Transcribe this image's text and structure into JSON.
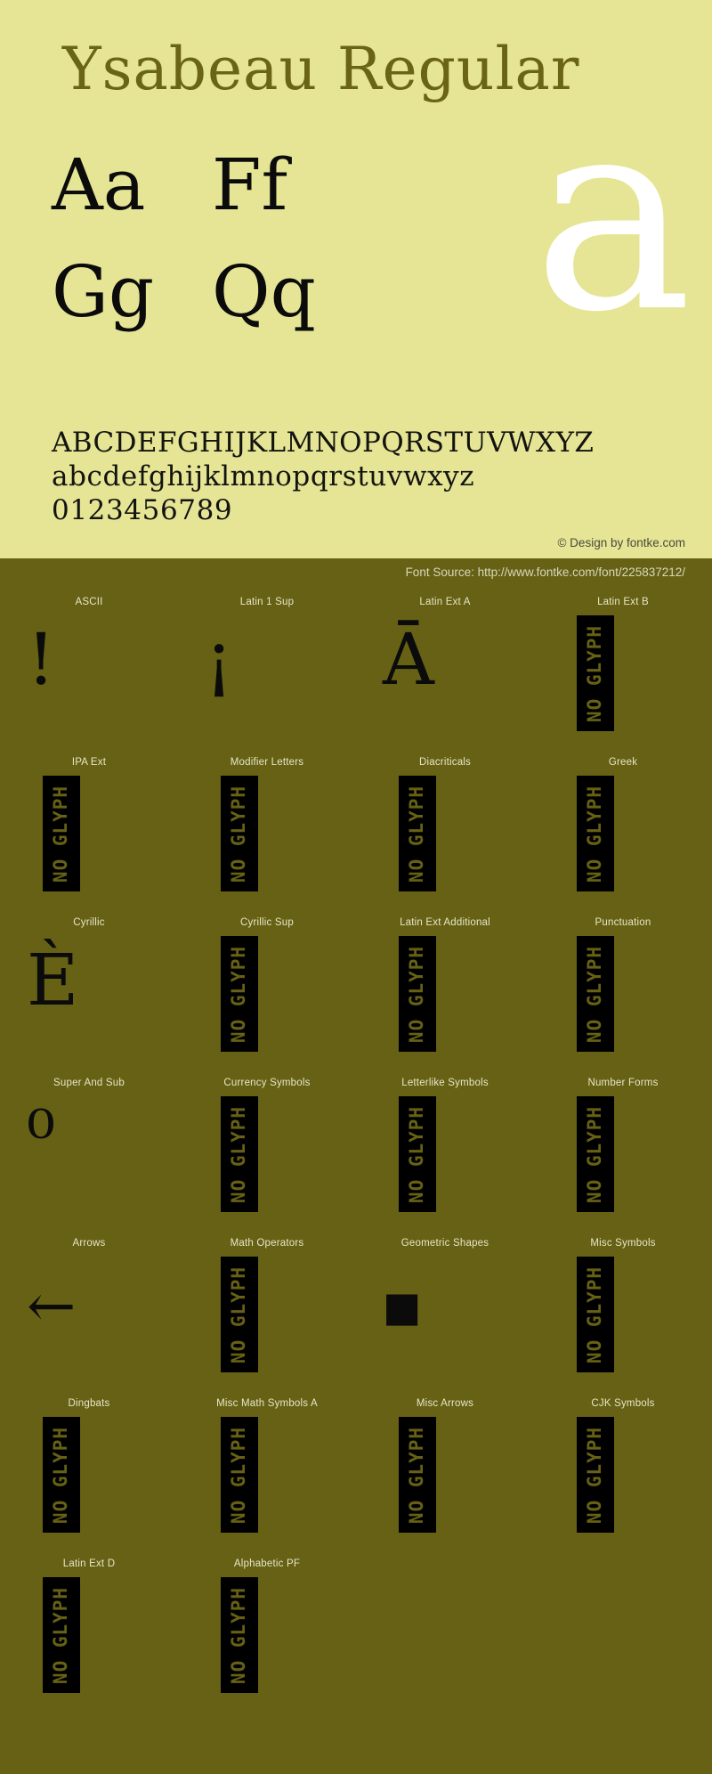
{
  "colors": {
    "light_bg": "#e5e595",
    "dark_bg": "#666114",
    "title_color": "#6a6516",
    "glyph_color": "#0b0b0b",
    "watermark_color": "#ffffff",
    "label_color": "#e6e6c8"
  },
  "specimen": {
    "title": "Ysabeau Regular",
    "watermark_letter": "a",
    "sample_pairs": [
      {
        "col1": "Aa",
        "col2": "Ff"
      },
      {
        "col1": "Gg",
        "col2": "Qq"
      }
    ],
    "alphabet_upper": "ABCDEFGHIJKLMNOPQRSTUVWXYZ",
    "alphabet_lower": "abcdefghijklmnopqrstuvwxyz",
    "digits": "0123456789",
    "copyright": "© Design by fontke.com"
  },
  "coverage": {
    "font_source": "Font Source: http://www.fontke.com/font/225837212/",
    "no_glyph_label": "NO GLYPH",
    "rows": [
      [
        {
          "label": "ASCII",
          "glyph": "!",
          "no_glyph": false
        },
        {
          "label": "Latin 1 Sup",
          "glyph": "¡",
          "no_glyph": false
        },
        {
          "label": "Latin Ext A",
          "glyph": "Ā",
          "no_glyph": false
        },
        {
          "label": "Latin Ext B",
          "glyph": "",
          "no_glyph": true
        }
      ],
      [
        {
          "label": "IPA Ext",
          "glyph": "",
          "no_glyph": true
        },
        {
          "label": "Modifier Letters",
          "glyph": "",
          "no_glyph": true
        },
        {
          "label": "Diacriticals",
          "glyph": "",
          "no_glyph": true
        },
        {
          "label": "Greek",
          "glyph": "",
          "no_glyph": true
        }
      ],
      [
        {
          "label": "Cyrillic",
          "glyph": "È",
          "no_glyph": false
        },
        {
          "label": "Cyrillic Sup",
          "glyph": "",
          "no_glyph": true
        },
        {
          "label": "Latin Ext Additional",
          "glyph": "",
          "no_glyph": true
        },
        {
          "label": "Punctuation",
          "glyph": "",
          "no_glyph": true
        }
      ],
      [
        {
          "label": "Super And Sub",
          "glyph": "⁰",
          "no_glyph": false
        },
        {
          "label": "Currency Symbols",
          "glyph": "",
          "no_glyph": true
        },
        {
          "label": "Letterlike Symbols",
          "glyph": "",
          "no_glyph": true
        },
        {
          "label": "Number Forms",
          "glyph": "",
          "no_glyph": true
        }
      ],
      [
        {
          "label": "Arrows",
          "glyph": "←",
          "no_glyph": false
        },
        {
          "label": "Math Operators",
          "glyph": "",
          "no_glyph": true
        },
        {
          "label": "Geometric Shapes",
          "glyph": "■",
          "no_glyph": false
        },
        {
          "label": "Misc Symbols",
          "glyph": "",
          "no_glyph": true
        }
      ],
      [
        {
          "label": "Dingbats",
          "glyph": "",
          "no_glyph": true
        },
        {
          "label": "Misc Math Symbols A",
          "glyph": "",
          "no_glyph": true
        },
        {
          "label": "Misc Arrows",
          "glyph": "",
          "no_glyph": true
        },
        {
          "label": "CJK Symbols",
          "glyph": "",
          "no_glyph": true
        }
      ],
      [
        {
          "label": "Latin Ext D",
          "glyph": "",
          "no_glyph": true
        },
        {
          "label": "Alphabetic PF",
          "glyph": "",
          "no_glyph": true
        },
        {
          "label": "",
          "glyph": "",
          "no_glyph": false
        },
        {
          "label": "",
          "glyph": "",
          "no_glyph": false
        }
      ]
    ]
  }
}
